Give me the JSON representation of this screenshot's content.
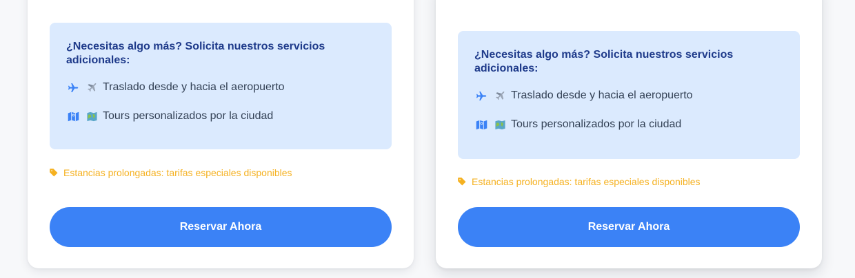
{
  "cards": [
    {
      "services_title": "¿Necesitas algo más? Solicita nuestros servicios adicionales:",
      "services": [
        {
          "icon": "plane-icon",
          "emoji": "✈️",
          "label": "Traslado desde y hacia el aeropuerto"
        },
        {
          "icon": "map-icon",
          "emoji": "🗺️",
          "label": "Tours personalizados por la ciudad"
        }
      ],
      "promo_text": "Estancias prolongadas: tarifas especiales disponibles",
      "reserve_label": "Reservar Ahora"
    },
    {
      "services_title": "¿Necesitas algo más? Solicita nuestros servicios adicionales:",
      "services": [
        {
          "icon": "plane-icon",
          "emoji": "✈️",
          "label": "Traslado desde y hacia el aeropuerto"
        },
        {
          "icon": "map-icon",
          "emoji": "🗺️",
          "label": "Tours personalizados por la ciudad"
        }
      ],
      "promo_text": "Estancias prolongadas: tarifas especiales disponibles",
      "reserve_label": "Reservar Ahora"
    }
  ],
  "colors": {
    "page_background": "#f7f8fa",
    "services_background": "#dbeafe",
    "services_title": "#1e3a8a",
    "icon_blue": "#3b82f6",
    "promo_text": "#f5b120",
    "button": "#3b82f6"
  }
}
